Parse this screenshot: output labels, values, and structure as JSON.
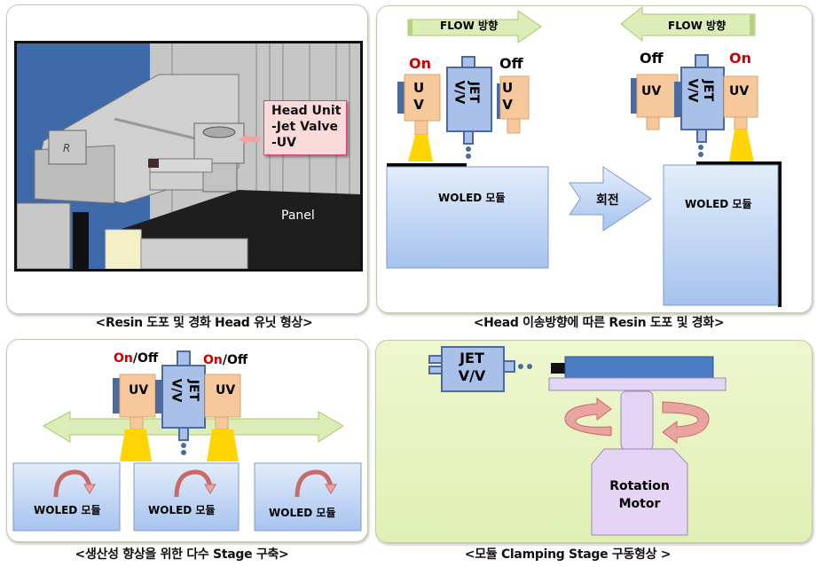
{
  "panels": {
    "head_unit": {
      "caption": "<Resin 도포 및 경화 Head 유닛 형상>",
      "callout_title": "Head Unit",
      "callout_items": [
        "-Jet Valve",
        "-UV"
      ],
      "panel_label": "Panel",
      "logo_glyph": "R"
    },
    "flow_direction": {
      "caption": "<Head 이송방향에 따른 Resin 도포 및 경화>",
      "flow_label_left": "FLOW 방향",
      "flow_label_right": "FLOW 방향",
      "left_uv_state": "On",
      "right_uv_state": "Off",
      "uv_label_vertical_top": "U",
      "uv_label_vertical_bottom": "V",
      "jet_label": "JET",
      "vv_label": "V/V",
      "module_label": "WOLED 모듈",
      "rotate_label": "회전",
      "after_left_uv_state": "Off",
      "after_right_uv_state": "On",
      "uv_label": "UV"
    },
    "multi_stage": {
      "caption": "<생산성 향상을 위한 다수 Stage 구축>",
      "on_text": "On",
      "off_text": "/Off",
      "uv_label": "UV",
      "jet_label": "JET",
      "vv_label": "V/V",
      "modules": [
        "WOLED 모듈",
        "WOLED 모듈",
        "WOLED 모듈"
      ]
    },
    "clamping": {
      "caption": "<모듈 Clamping Stage 구동형상 >",
      "jet_label": "JET",
      "vv_label": "V/V",
      "motor_line1": "Rotation",
      "motor_line2": "Motor"
    }
  },
  "colors": {
    "on_red": "#cc0000",
    "uv_orange": "#f7c89b",
    "jet_blue": "#a9c1e8",
    "jet_border": "#4a6aa0",
    "uv_beam": "#ffd400",
    "module_blue": "#c9dcf6",
    "arrow_green": "#dcedb8",
    "motor_purple": "#e3d5f3",
    "stage_blue": "#4a7bc4",
    "rotate_pink": "#e9a4a0"
  }
}
